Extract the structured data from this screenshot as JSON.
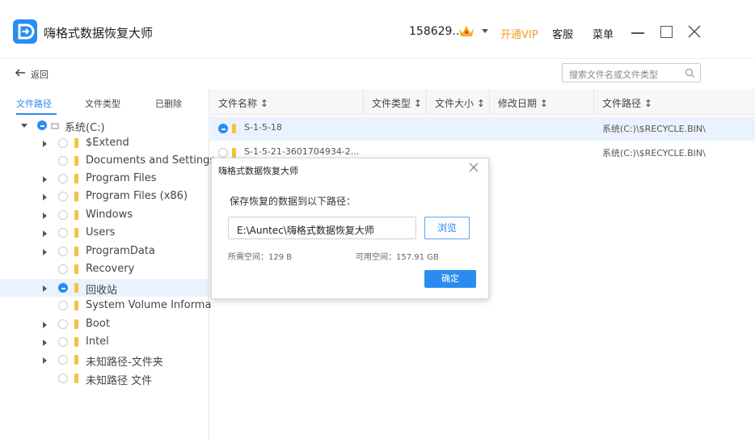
{
  "app": {
    "title": "嗨格式数据恢复大师",
    "account": "158629...",
    "vip_label": "开通VIP",
    "service_label": "客服",
    "menu_label": "菜单"
  },
  "toolbar": {
    "back_label": "返回",
    "search_placeholder": "搜索文件名或文件类型"
  },
  "left_tabs": [
    "文件路径",
    "文件类型",
    "已删除"
  ],
  "tree": [
    {
      "label": "系统(C:)",
      "expander": "down",
      "checked": true,
      "drive": true
    },
    {
      "label": "$Extend",
      "expander": "right",
      "checked": false
    },
    {
      "label": "Documents and Settings",
      "expander": "none",
      "checked": false
    },
    {
      "label": "Program Files",
      "expander": "right",
      "checked": false
    },
    {
      "label": "Program Files (x86)",
      "expander": "right",
      "checked": false
    },
    {
      "label": "Windows",
      "expander": "right",
      "checked": false
    },
    {
      "label": "Users",
      "expander": "right",
      "checked": false
    },
    {
      "label": "ProgramData",
      "expander": "right",
      "checked": false
    },
    {
      "label": "Recovery",
      "expander": "none",
      "checked": false
    },
    {
      "label": "回收站",
      "expander": "right",
      "checked": true,
      "selected": true
    },
    {
      "label": "System Volume Informa",
      "expander": "none",
      "checked": false
    },
    {
      "label": "Boot",
      "expander": "right",
      "checked": false
    },
    {
      "label": "Intel",
      "expander": "right",
      "checked": false
    },
    {
      "label": "未知路径-文件夹",
      "expander": "right",
      "checked": false
    },
    {
      "label": "未知路径 文件",
      "expander": "none",
      "checked": false
    }
  ],
  "table": {
    "columns": [
      "文件名称",
      "文件类型",
      "文件大小",
      "修改日期",
      "文件路径"
    ],
    "rows": [
      {
        "name": "S-1-5-18",
        "type": "",
        "size": "",
        "date": "",
        "path": "系统(C:)\\$RECYCLE.BIN\\",
        "checked": true,
        "selected": true
      },
      {
        "name": "S-1-5-21-3601704934-2...",
        "type": "",
        "size": "",
        "date": "",
        "path": "系统(C:)\\$RECYCLE.BIN\\",
        "checked": false
      }
    ]
  },
  "dialog": {
    "title": "嗨格式数据恢复大师",
    "prompt": "保存恢复的数据到以下路径：",
    "path_value": "E:\\Auntec\\嗨格式数据恢复大师",
    "browse_label": "浏览",
    "need_space": "所需空间：129 B",
    "free_space": "可用空间：157.91 GB",
    "ok_label": "确定"
  },
  "colors": {
    "accent": "#2a8cf0",
    "vip": "#f0a020",
    "folder": "#f5c242",
    "selection": "#eaf3fd"
  }
}
